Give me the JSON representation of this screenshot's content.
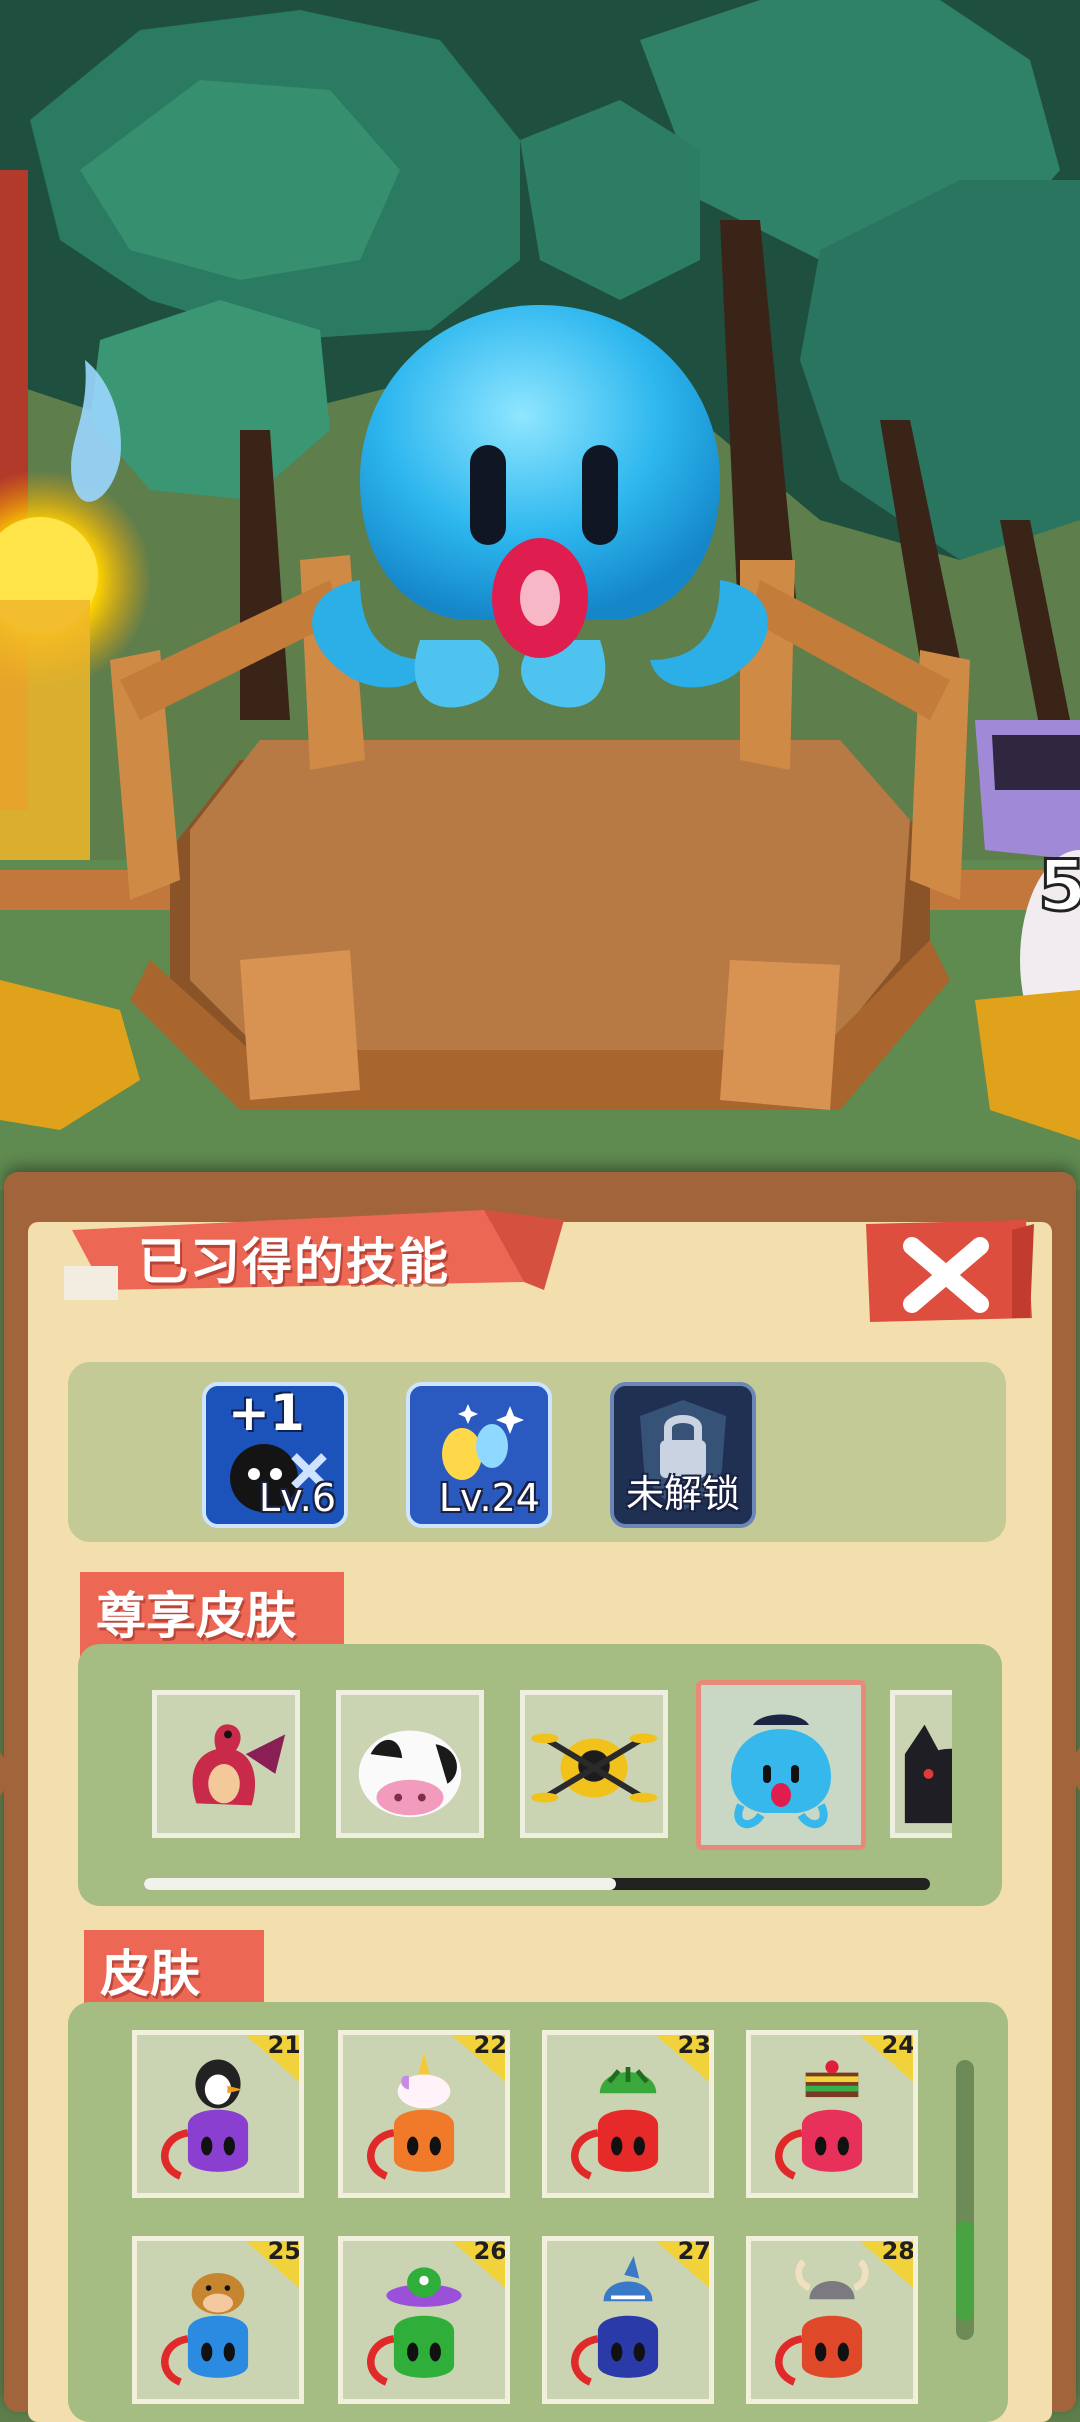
{
  "panel": {
    "title": "已习得的技能",
    "close_icon": "close-x-icon"
  },
  "skills": [
    {
      "badge": "+1",
      "level": "Lv.6",
      "icon": "bomb-plus-one-icon"
    },
    {
      "level": "Lv.24",
      "icon": "sparkle-eggs-icon"
    },
    {
      "locked_label": "未解锁",
      "icon": "lock-shield-icon"
    }
  ],
  "premium": {
    "label": "尊享皮肤",
    "items": [
      {
        "name": "dragon-skin"
      },
      {
        "name": "cow-skin"
      },
      {
        "name": "drone-skin"
      },
      {
        "name": "blue-octopus-skin",
        "selected": true
      },
      {
        "name": "black-cat-skin"
      }
    ],
    "scroll_progress": 0.6
  },
  "skins": {
    "label": "皮肤",
    "items": [
      {
        "number": "21",
        "name": "penguin-purple-skin",
        "body": "#8a3fd0",
        "topper": "penguin"
      },
      {
        "number": "22",
        "name": "unicorn-orange-skin",
        "body": "#f07a2a",
        "topper": "unicorn"
      },
      {
        "number": "23",
        "name": "watermelon-red-skin",
        "body": "#e62a2a",
        "topper": "watermelon"
      },
      {
        "number": "24",
        "name": "cake-pink-skin",
        "body": "#e8315a",
        "topper": "cake"
      },
      {
        "number": "25",
        "name": "cow-blue-skin",
        "body": "#2a8be0",
        "topper": "cowhead"
      },
      {
        "number": "26",
        "name": "ufo-green-skin",
        "body": "#2fae3a",
        "topper": "ufo"
      },
      {
        "number": "27",
        "name": "shark-navy-skin",
        "body": "#2a3aa8",
        "topper": "shark"
      },
      {
        "number": "28",
        "name": "viking-orange-skin",
        "body": "#e0482a",
        "topper": "viking"
      }
    ],
    "scroll_position": 0.45
  },
  "colors": {
    "panel_frame": "#a2643a",
    "panel_fill": "#f3dfae",
    "ribbon": "#ec6754",
    "close_button": "#de4e3e",
    "section_green": "#a5bd82",
    "number_badge": "#f2d23a"
  }
}
